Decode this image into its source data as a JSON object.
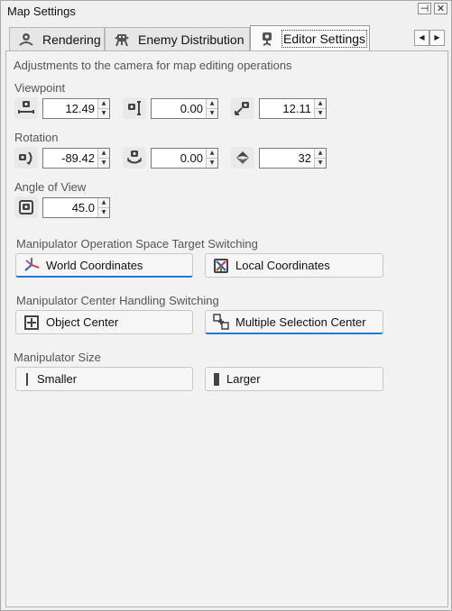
{
  "window": {
    "title": "Map Settings",
    "pin_glyph": "⊣",
    "close_glyph": "✕"
  },
  "tabs": [
    {
      "label": "Rendering",
      "icon": "rendering-icon",
      "active": false
    },
    {
      "label": "Enemy Distribution",
      "icon": "enemy-icon",
      "active": false
    },
    {
      "label": "Editor Settings",
      "icon": "camera-icon",
      "active": true
    }
  ],
  "tab_scroll": {
    "left": "◀",
    "right": "▶"
  },
  "panel": {
    "description": "Adjustments to the camera for map editing operations",
    "viewpoint": {
      "label": "Viewpoint",
      "fields": [
        {
          "icon": "camera-pan-horizontal-icon",
          "value": "12.49"
        },
        {
          "icon": "camera-pan-vertical-icon",
          "value": "0.00"
        },
        {
          "icon": "camera-zoom-icon",
          "value": "12.11"
        }
      ]
    },
    "rotation": {
      "label": "Rotation",
      "fields": [
        {
          "icon": "camera-rotate-yaw-icon",
          "value": "-89.42"
        },
        {
          "icon": "camera-rotate-roll-icon",
          "value": "0.00"
        },
        {
          "icon": "camera-pitch-icon",
          "value": "32"
        }
      ]
    },
    "angle_of_view": {
      "label": "Angle of View",
      "fields": [
        {
          "icon": "camera-fov-icon",
          "value": "45.0"
        }
      ]
    },
    "space_switching": {
      "label": "Manipulator Operation Space Target Switching",
      "world": "World Coordinates",
      "local": "Local Coordinates",
      "selected": "world"
    },
    "center_switching": {
      "label": "Manipulator Center Handling Switching",
      "object": "Object Center",
      "multiple": "Multiple Selection Center",
      "selected": "multiple"
    },
    "size": {
      "label": "Manipulator Size",
      "smaller": "Smaller",
      "larger": "Larger"
    }
  },
  "colors": {
    "accent": "#1f78d1",
    "background": "#f0f0f0",
    "border": "#b6b6b6"
  }
}
